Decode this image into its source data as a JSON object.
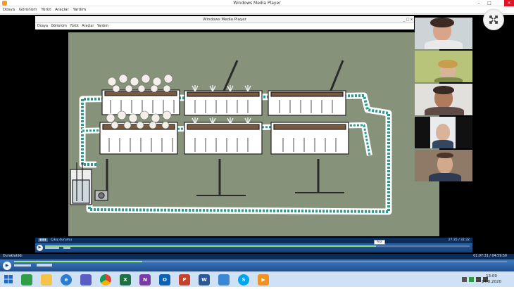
{
  "outer_window": {
    "title": "Windows Media Player",
    "menu": [
      "Dosya",
      "Görünüm",
      "Yürüt",
      "Araçlar",
      "Yardım"
    ],
    "controls": [
      "–",
      "□",
      "✕"
    ]
  },
  "inner_window": {
    "title": "Windows Media Player",
    "menu": [
      "Dosya",
      "Görünüm",
      "Yürüt",
      "Araçlar",
      "Yardım"
    ],
    "controls": "_ □ x",
    "status_left": "Çıkış durumu",
    "time": "27:35 / 32:32",
    "tooltip": "Ara",
    "progress": 0.78
  },
  "outer_player": {
    "status_left": "Duraklatıldı",
    "time": "01:07:31 / 04:59:59",
    "progress": 0.26
  },
  "participants": [
    "participant-1",
    "participant-2",
    "participant-3",
    "participant-4",
    "participant-5"
  ],
  "taskbar": {
    "apps": [
      "start",
      "store",
      "file-explorer",
      "internet-explorer",
      "calculator",
      "chrome",
      "excel",
      "onenote",
      "outlook",
      "powerpoint",
      "word",
      "remote-desktop",
      "skype",
      "media-player"
    ],
    "time": "13:09",
    "date": "14.8.2020"
  }
}
